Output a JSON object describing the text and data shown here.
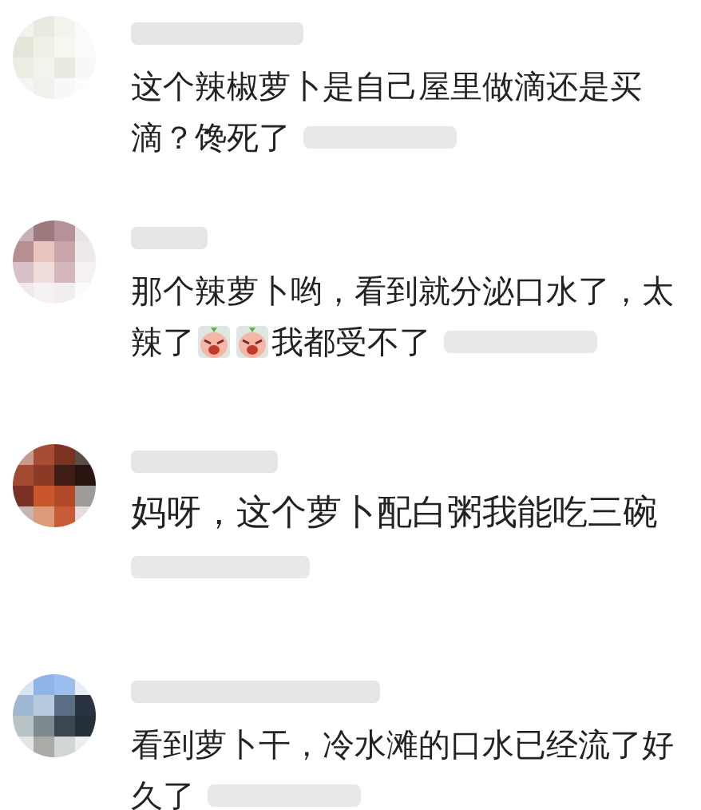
{
  "comments": [
    {
      "lines": [
        [
          {
            "kind": "text",
            "text": "这个辣椒萝卜是自己屋里做滴还是买"
          }
        ],
        [
          {
            "kind": "text",
            "text": "滴？馋死了"
          }
        ]
      ]
    },
    {
      "lines": [
        [
          {
            "kind": "text",
            "text": "那个辣萝卜哟，看到就分泌口水了，太"
          }
        ],
        [
          {
            "kind": "text",
            "text": "辣了"
          },
          {
            "kind": "emoji"
          },
          {
            "kind": "emoji"
          },
          {
            "kind": "text",
            "text": "我都受不了"
          }
        ]
      ]
    },
    {
      "lines": [
        [
          {
            "kind": "text",
            "text": "妈呀，这个萝卜配白粥我能吃三碗"
          }
        ]
      ]
    },
    {
      "lines": [
        [
          {
            "kind": "text",
            "text": "看到萝卜干，冷水滩的口水已经流了好"
          }
        ],
        [
          {
            "kind": "text",
            "text": "久了"
          }
        ]
      ]
    }
  ]
}
